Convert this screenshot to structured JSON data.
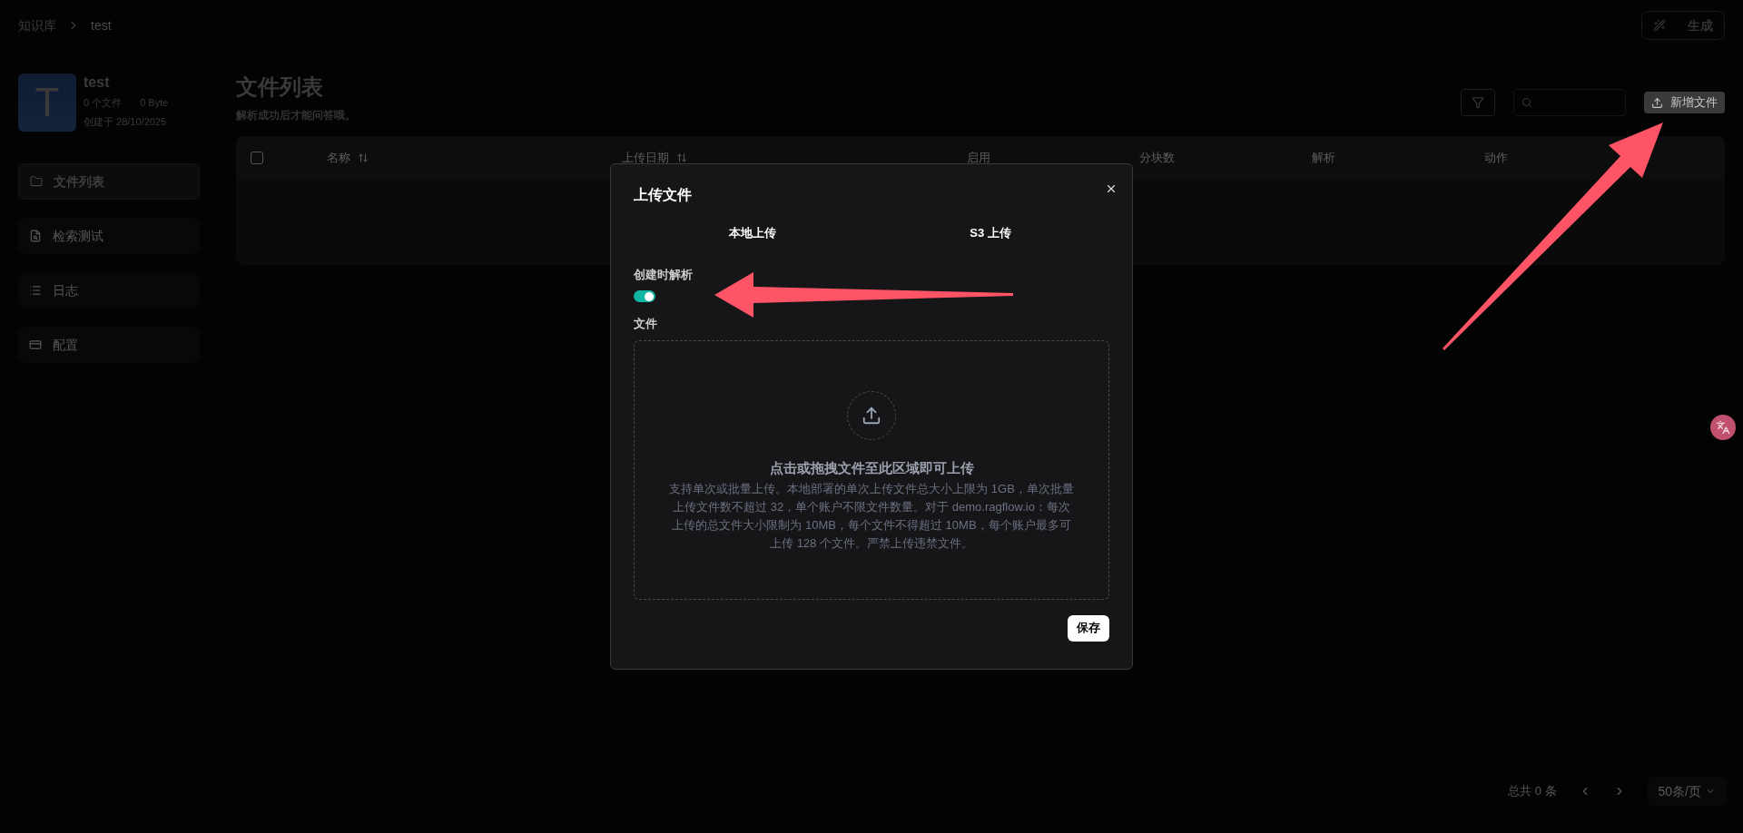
{
  "breadcrumb": [
    "知识库",
    "test"
  ],
  "top_button": {
    "label": "生成"
  },
  "dataset": {
    "avatar_letter": "T",
    "name": "test",
    "file_count": "0 个文件",
    "size": "0 Byte",
    "created": "创建于 28/10/2025"
  },
  "sidebar": {
    "items": [
      {
        "label": "文件列表",
        "kind": "folder",
        "selected": true
      },
      {
        "label": "检索测试",
        "kind": "search",
        "selected": false
      },
      {
        "label": "日志",
        "kind": "list",
        "selected": false
      },
      {
        "label": "配置",
        "kind": "card",
        "selected": false
      }
    ]
  },
  "page": {
    "title": "文件列表",
    "subtitle": "解析成功后才能问答哦。",
    "add_button": "新增文件"
  },
  "table": {
    "select_all_checked": false,
    "columns": [
      {
        "label": "名称",
        "sortable": true
      },
      {
        "label": "上传日期",
        "sortable": true
      },
      {
        "label": "启用",
        "sortable": false
      },
      {
        "label": "分块数",
        "sortable": false
      },
      {
        "label": "解析",
        "sortable": false
      },
      {
        "label": "动作",
        "sortable": false
      }
    ]
  },
  "pagination": {
    "total": "总共 0 条",
    "page_size": "50条/页"
  },
  "dialog": {
    "title": "上传文件",
    "tabs": [
      "本地上传",
      "S3 上传"
    ],
    "parse_label": "创建时解析",
    "parse_on": true,
    "file_label": "文件",
    "drop_title": "点击或拖拽文件至此区域即可上传",
    "drop_text": "支持单次或批量上传。本地部署的单次上传文件总大小上限为 1GB，单次批量上传文件数不超过 32，单个账户不限文件数量。对于 demo.ragflow.io：每次上传的总文件大小限制为 10MB，每个文件不得超过 10MB，每个账户最多可上传 128 个文件。严禁上传违禁文件。",
    "save": "保存"
  }
}
